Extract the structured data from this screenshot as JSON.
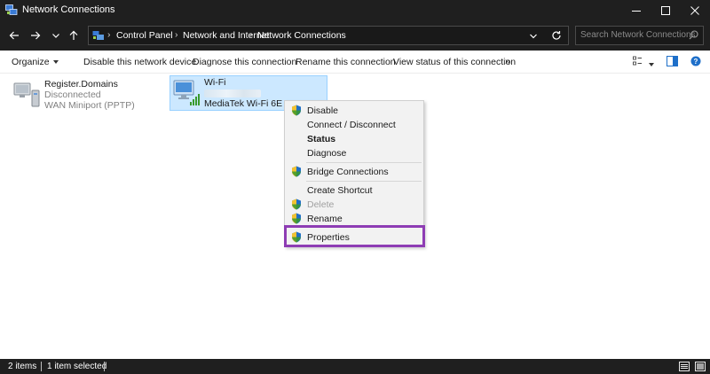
{
  "window": {
    "title": "Network Connections"
  },
  "address": {
    "breadcrumbs": [
      "Control Panel",
      "Network and Internet",
      "Network Connections"
    ],
    "search_placeholder": "Search Network Connections"
  },
  "commands": {
    "organize": "Organize",
    "actions": [
      "Disable this network device",
      "Diagnose this connection",
      "Rename this connection",
      "View status of this connection"
    ],
    "more": "»"
  },
  "connections": [
    {
      "name": "Register.Domains",
      "status": "Disconnected",
      "device": "WAN Miniport (PPTP)",
      "icon": "vpn-connection-icon",
      "selected": false
    },
    {
      "name": "Wi-Fi",
      "device": "MediaTek Wi-Fi 6E MT7",
      "icon": "wifi-adapter-icon",
      "selected": true
    }
  ],
  "context_menu": {
    "items": [
      {
        "label": "Disable",
        "shield": true
      },
      {
        "label": "Connect / Disconnect",
        "shield": false
      },
      {
        "label": "Status",
        "shield": false,
        "bold": true
      },
      {
        "label": "Diagnose",
        "shield": false
      },
      {
        "label": "Bridge Connections",
        "shield": true
      },
      {
        "label": "Create Shortcut",
        "shield": false
      },
      {
        "label": "Delete",
        "shield": true,
        "disabled": true
      },
      {
        "label": "Rename",
        "shield": true
      },
      {
        "label": "Properties",
        "shield": true,
        "highlighted": true
      }
    ],
    "highlight_color": "#8e3db4"
  },
  "status_bar": {
    "item_count": "2 items",
    "selection": "1 item selected"
  },
  "colors": {
    "chrome_bg": "#1f1f1f",
    "selection_bg": "#cce8ff",
    "selection_border": "#99d1ff"
  }
}
